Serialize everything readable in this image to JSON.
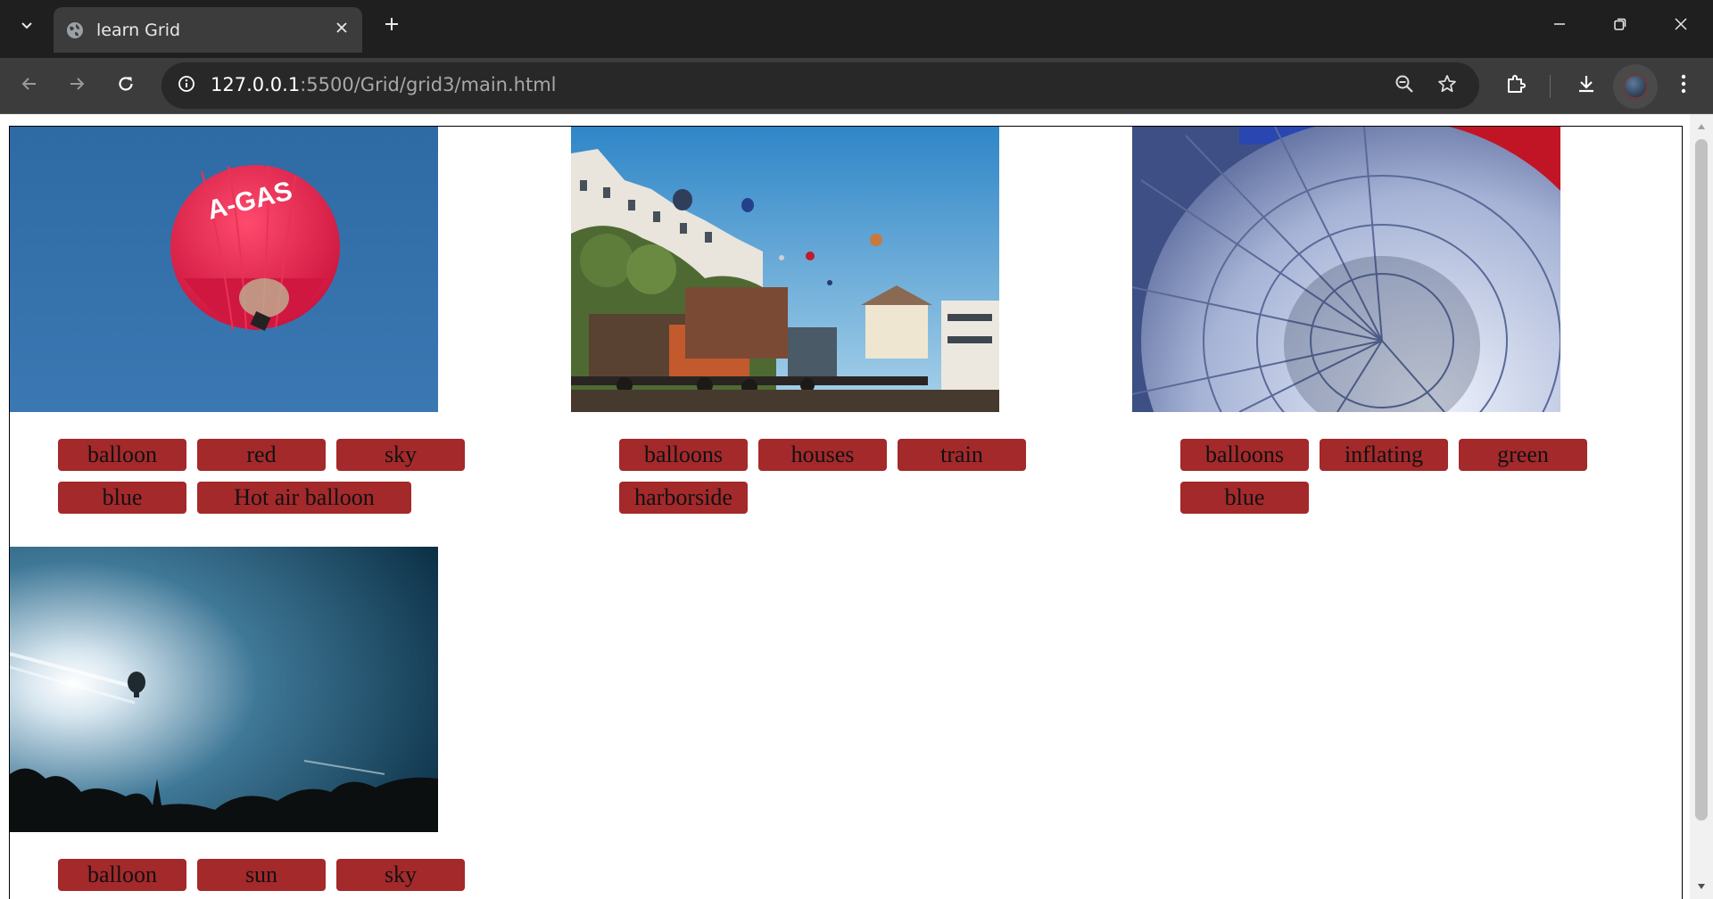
{
  "browser": {
    "tab_title": "learn Grid",
    "url_host": "127.0.0.1",
    "url_rest": ":5500/Grid/grid3/main.html"
  },
  "colors": {
    "tag_bg": "#a4292b",
    "tab_active": "#3c3c3c",
    "chrome_dark": "#1f1f1f"
  },
  "icons": {
    "tab_list": "chevron-down-icon",
    "favicon": "globe-icon",
    "tab_close": "close-icon",
    "new_tab": "plus-icon",
    "minimize": "minimize-icon",
    "restore": "restore-icon",
    "close": "close-icon",
    "back": "arrow-left-icon",
    "forward": "arrow-right-icon",
    "reload": "reload-icon",
    "site_info": "info-icon",
    "zoom": "zoom-out-icon",
    "bookmark": "star-icon",
    "extensions": "puzzle-icon",
    "downloads": "download-icon",
    "menu": "kebab-menu-icon"
  },
  "gallery": [
    {
      "image": "red hot air balloon against blue sky",
      "tags": [
        "balloon",
        "red",
        "sky",
        "blue",
        "Hot air balloon"
      ]
    },
    {
      "image": "balloons over houses and old train wagons",
      "tags": [
        "balloons",
        "houses",
        "train",
        "harborside"
      ]
    },
    {
      "image": "inflating blue and red balloon envelopes",
      "tags": [
        "balloons",
        "inflating",
        "green",
        "blue"
      ]
    },
    {
      "image": "balloon silhouette near the sun",
      "tags": [
        "balloon",
        "sun",
        "sky"
      ]
    }
  ]
}
